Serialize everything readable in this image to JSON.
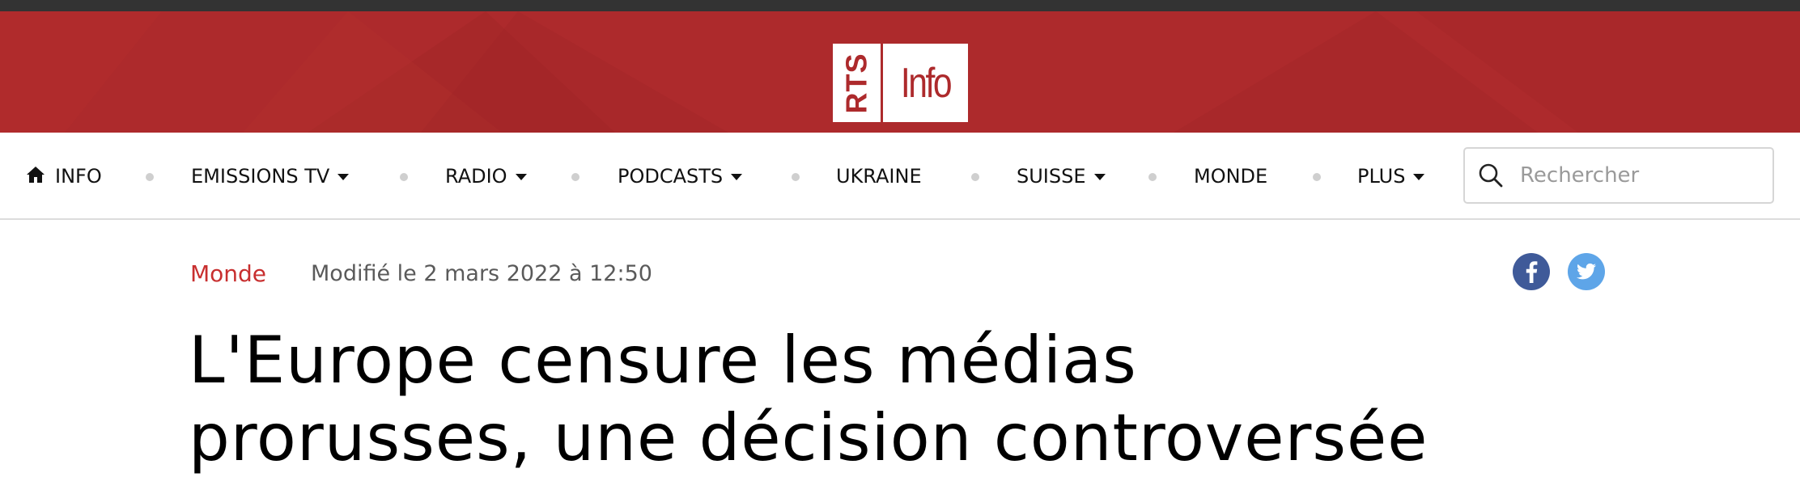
{
  "header": {
    "logo": {
      "brand": "RTS",
      "product": "Info"
    },
    "colors": {
      "banner": "#ad2a2c",
      "topbar": "#333333",
      "accent": "#c82f2f"
    }
  },
  "nav": {
    "items": [
      {
        "label": "INFO",
        "icon": "home-icon",
        "dropdown": false
      },
      {
        "label": "EMISSIONS TV",
        "dropdown": true
      },
      {
        "label": "RADIO",
        "dropdown": true
      },
      {
        "label": "PODCASTS",
        "dropdown": true
      },
      {
        "label": "UKRAINE",
        "dropdown": false
      },
      {
        "label": "SUISSE",
        "dropdown": true
      },
      {
        "label": "MONDE",
        "dropdown": false
      },
      {
        "label": "PLUS",
        "dropdown": true
      }
    ],
    "search": {
      "placeholder": "Rechercher",
      "value": "",
      "icon": "search-icon"
    }
  },
  "article": {
    "section": "Monde",
    "modified": "Modifié le 2 mars 2022 à 12:50",
    "share": {
      "facebook_icon": "facebook-icon",
      "twitter_icon": "twitter-icon"
    },
    "headline": [
      "L'Europe censure les médias",
      "prorusses, une décision controversée"
    ]
  }
}
